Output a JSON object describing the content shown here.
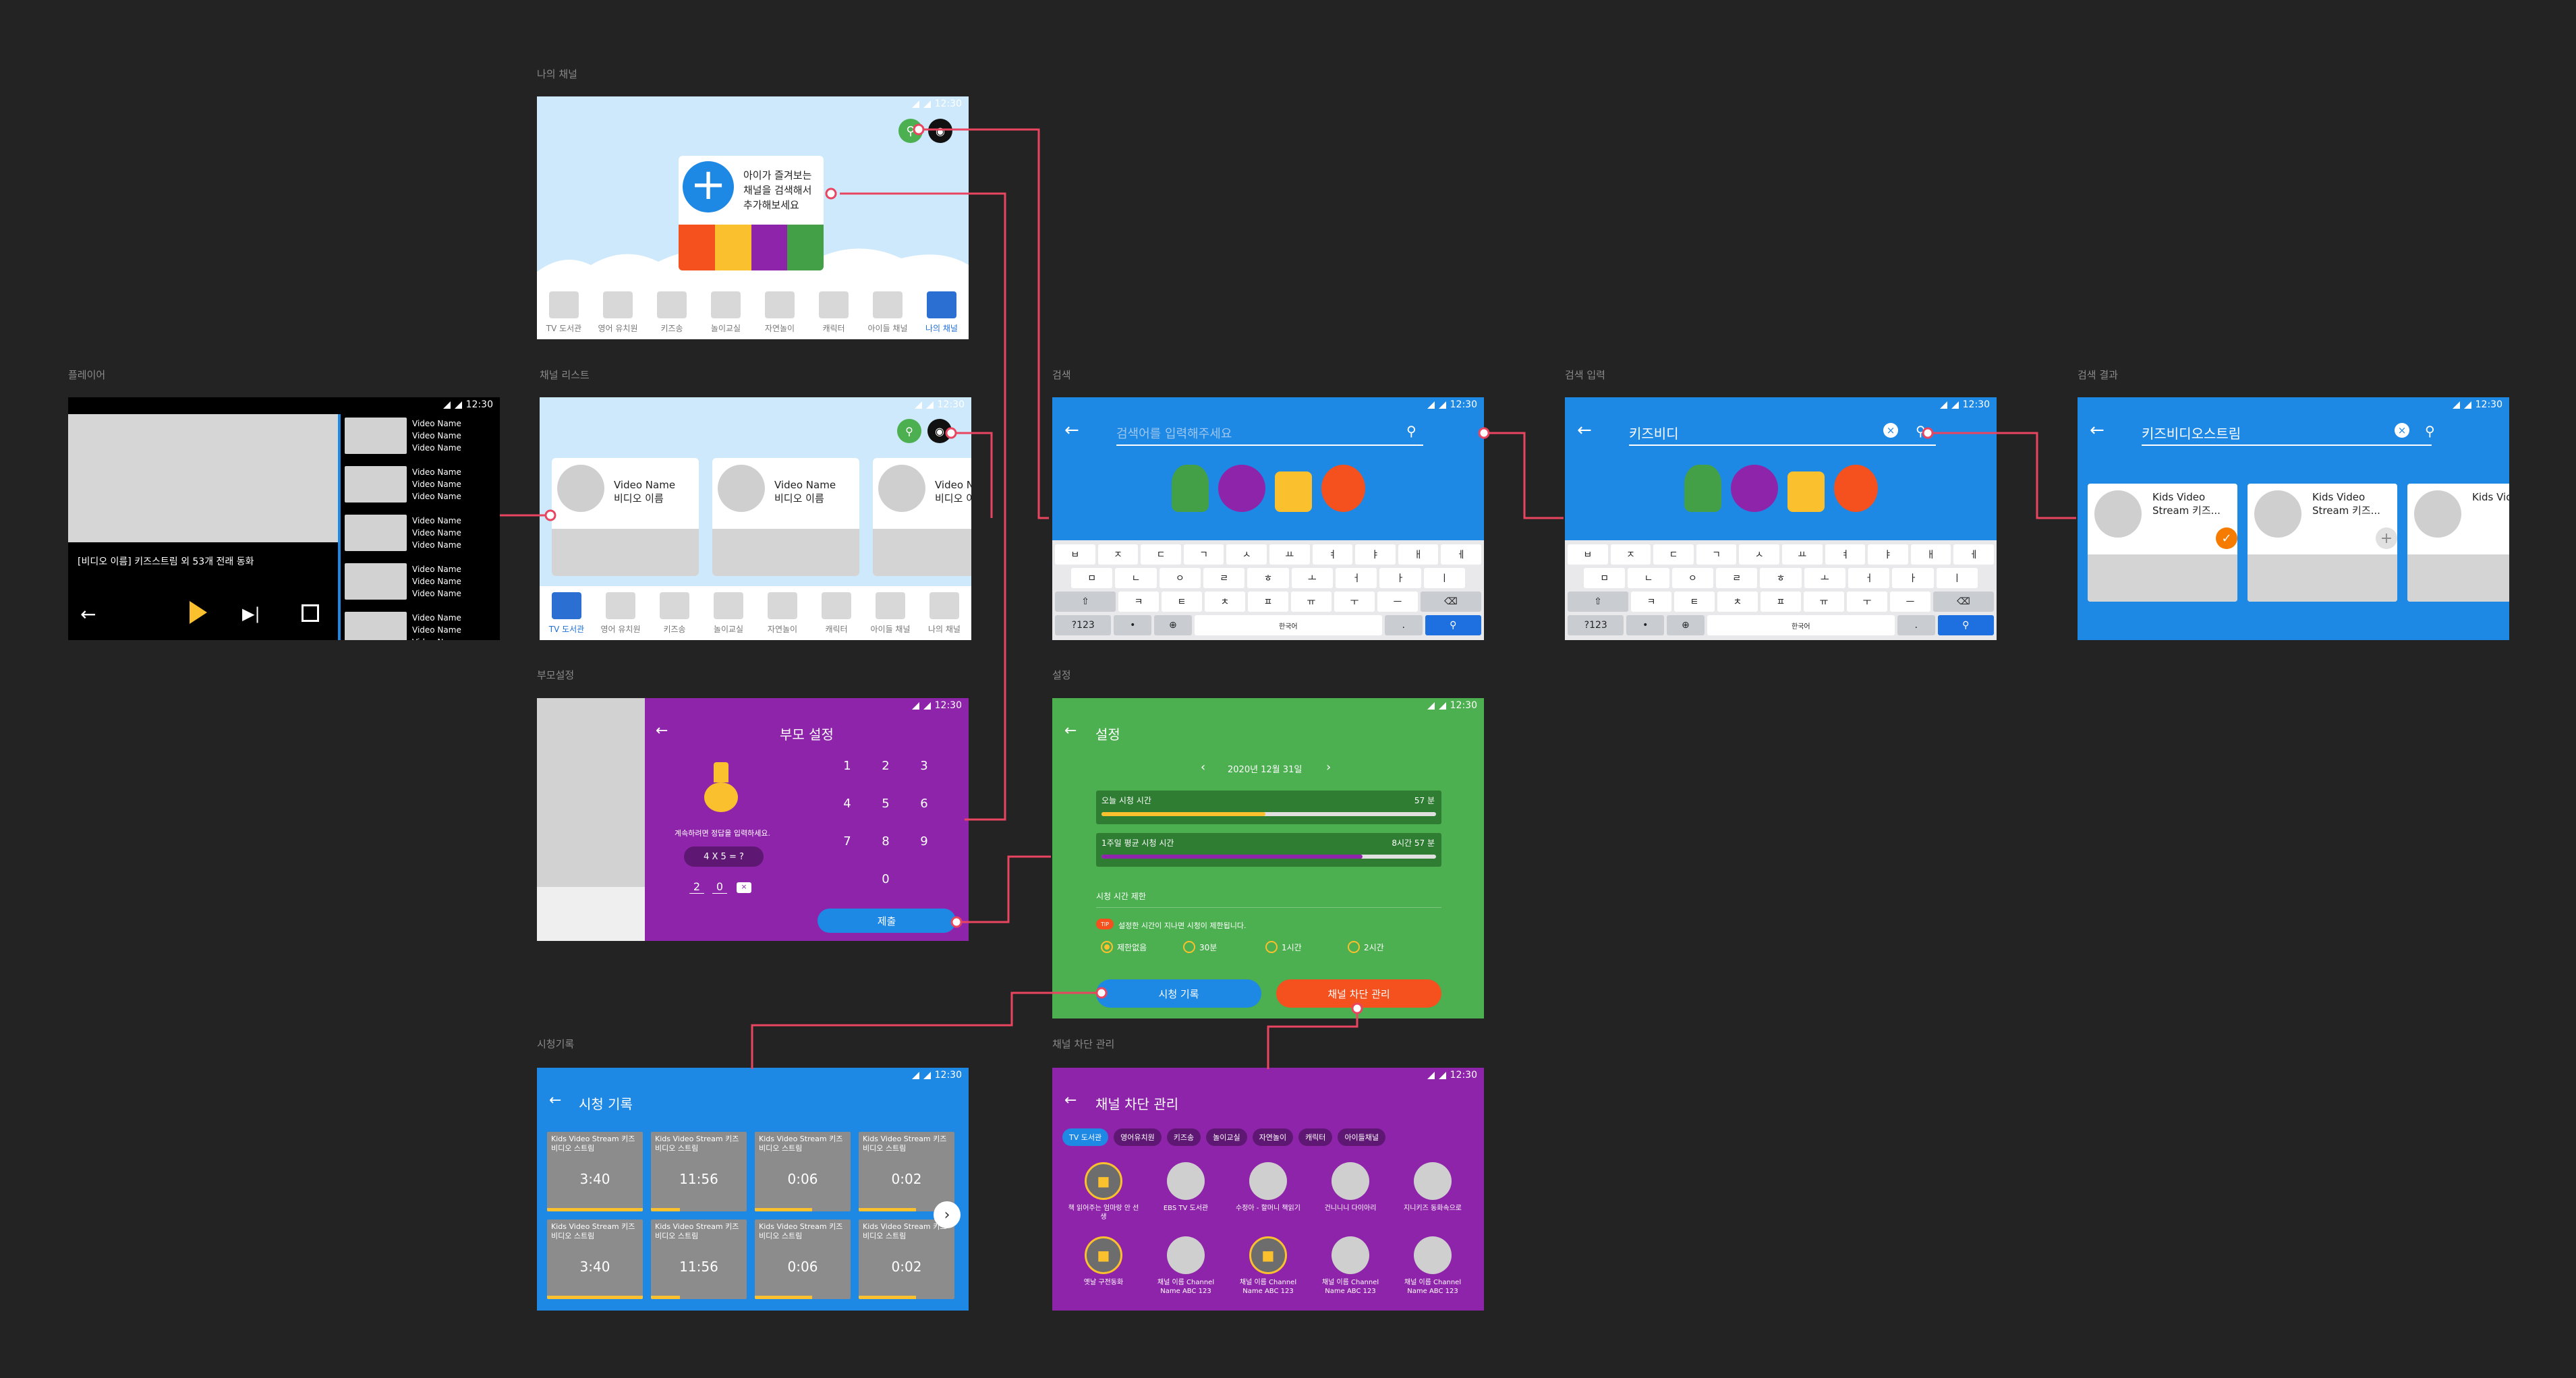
{
  "frames": {
    "my_channel": "나의 채널",
    "player": "플레이어",
    "channel_list": "채널 리스트",
    "search": "검색",
    "search_input": "검색 입력",
    "search_result": "검색 결과",
    "parent_settings": "부모설정",
    "settings": "설정",
    "watch_history": "시청기록",
    "channel_block": "채널 차단 관리"
  },
  "status_time": "12:30",
  "nav_items": [
    "TV 도서관",
    "영어 유치원",
    "키즈송",
    "놀이교실",
    "자연놀이",
    "캐릭터",
    "아이들 채널",
    "나의 채널"
  ],
  "my_channel": {
    "promo_line1": "아이가 즐겨보는",
    "promo_line2": "채널을 검색해서",
    "promo_line3": "추가해보세요"
  },
  "player": {
    "title": "[비디오 이름] 키즈스트림 외 53개 전래 동화",
    "list_item": "Video Name"
  },
  "channel_list": {
    "card_name": "Video Name",
    "card_sub": "비디오 이름"
  },
  "search": {
    "placeholder": "검색어를 입력해주세요",
    "query_input": "키즈비디",
    "query_result": "키즈비디오스트림",
    "result_line1": "Kids Video",
    "result_line2": "Stream 키즈...",
    "result_short": "Kids Vid"
  },
  "keyboard": {
    "row1": [
      "ㅂ",
      "ㅈ",
      "ㄷ",
      "ㄱ",
      "ㅅ",
      "ㅛ",
      "ㅕ",
      "ㅑ",
      "ㅐ",
      "ㅔ"
    ],
    "row2": [
      "ㅁ",
      "ㄴ",
      "ㅇ",
      "ㄹ",
      "ㅎ",
      "ㅗ",
      "ㅓ",
      "ㅏ",
      "ㅣ"
    ],
    "row3": [
      "ㅋ",
      "ㅌ",
      "ㅊ",
      "ㅍ",
      "ㅠ",
      "ㅜ",
      "ㅡ"
    ],
    "sym": "?123",
    "space": "한국어",
    "dot": "."
  },
  "parent": {
    "title": "부모 설정",
    "instruction": "계속하려면 정답을 입력하세요.",
    "question": "4 X 5 = ?",
    "ans1": "2",
    "ans2": "0",
    "keys": [
      "1",
      "2",
      "3",
      "4",
      "5",
      "6",
      "7",
      "8",
      "9",
      "0"
    ],
    "submit": "제출"
  },
  "settings": {
    "title": "설정",
    "date": "2020년 12월 31일",
    "today_label": "오늘 시청 시간",
    "today_value": "57 분",
    "today_progress": 0.49,
    "week_label": "1주일 평균 시청 시간",
    "week_value": "8시간 57 분",
    "week_progress": 0.78,
    "limit_title": "시청 시간 제한",
    "tip_badge": "TIP",
    "tip_text": "설정한 시간이 지나면 시청이 제한됩니다.",
    "options": [
      "제한없음",
      "30분",
      "1시간",
      "2시간"
    ],
    "history_btn": "시청 기록",
    "block_btn": "채널 차단 관리"
  },
  "history": {
    "title": "시청 기록",
    "card_title": "Kids Video Stream 키즈",
    "card_sub": "비디오 스트림",
    "durations": [
      "3:40",
      "11:56",
      "0:06",
      "0:02"
    ]
  },
  "block": {
    "title": "채널 차단 관리",
    "tabs": [
      "TV 도서관",
      "영어유치원",
      "키즈송",
      "놀이교실",
      "자연놀이",
      "캐릭터",
      "아이들채널"
    ],
    "row1": [
      "책 읽어주는 엄마랑 안 선생",
      "EBS TV 도서관",
      "수정아 - 할머니 책읽기",
      "건니니니 다이아리",
      "지니키즈 동화속으로"
    ],
    "row2": [
      "옛날 구전동화",
      "채널 이름 Channel Name ABC 123",
      "채널 이름 Channel Name ABC 123",
      "채널 이름 Channel Name ABC 123",
      "채널 이름 Channel Name ABC 123"
    ]
  },
  "colors": {
    "blue": "#1e88e5",
    "green": "#4caf50",
    "purple": "#8e24aa",
    "orange": "#f4511e",
    "yellow": "#fbc02d",
    "connector": "#e94560"
  }
}
